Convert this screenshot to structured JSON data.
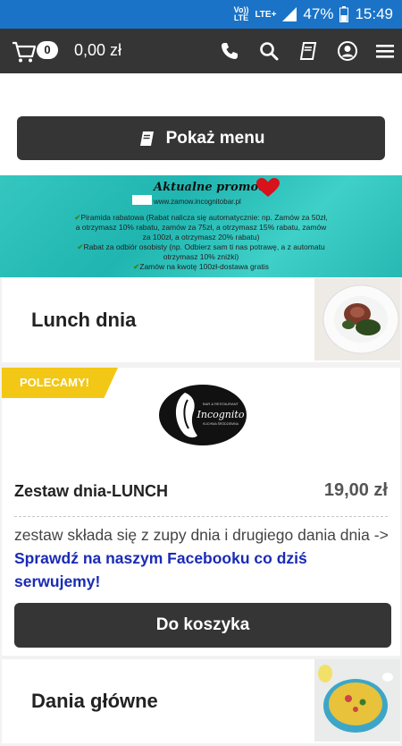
{
  "status_bar": {
    "volte": "Vo))",
    "lte_small": "LTE",
    "lte_plus": "LTE+",
    "battery": "47%",
    "time": "15:49"
  },
  "nav": {
    "cart_count": "0",
    "cart_total": "0,00 zł"
  },
  "menu_button": {
    "label": "Pokaż menu"
  },
  "promo": {
    "title": "Aktualne promocje",
    "url": "www.zamow.incognitobar.pl",
    "lines": [
      "Piramida rabatowa (Rabat nalicza się automatycznie: np. Zamów za 50zł, a otrzymasz 10% rabatu, zamów za 75zł, a otrzymasz 15% rabatu, zamów za 100zł, a otrzymasz 20% rabatu)",
      "Rabat za odbiór osobisty (np. Odbierz sam ti nas potrawę, a z automatu otrzymasz 10% zniżki)",
      "Zamów na kwotę 100zł-dostawa gratis"
    ]
  },
  "categories": [
    {
      "title": "Lunch dnia"
    },
    {
      "title": "Dania główne"
    }
  ],
  "product": {
    "badge": "POLECAMY!",
    "name": "Zestaw dnia-LUNCH",
    "price": "19,00 zł",
    "desc_plain": "zestaw składa się z zupy dnia i drugiego dania dnia -> ",
    "desc_link": "Sprawdź na naszym Facebooku co dziś serwujemy!",
    "add_button": "Do koszyka",
    "logo_text": "Incognito",
    "logo_small_top": "BAR & RESTAURANT",
    "logo_small_bottom": "KUCHNIA ŚRÓDZIEMNA"
  },
  "colors": {
    "status_bar": "#1a73c7",
    "nav_bar": "#353535",
    "badge": "#f2c716",
    "link": "#1a2bb5",
    "promo_bg": "#2ec0ba"
  }
}
